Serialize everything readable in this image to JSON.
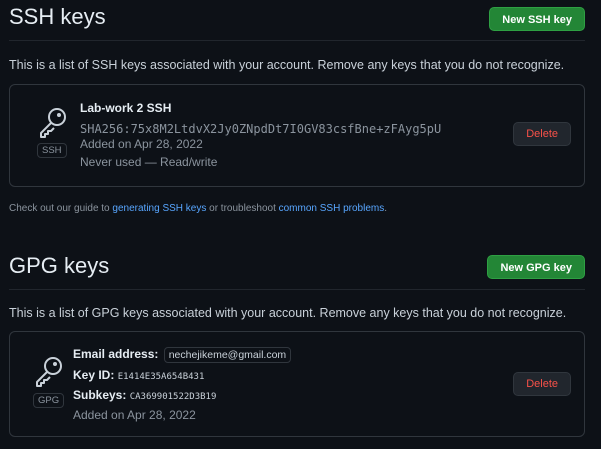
{
  "ssh": {
    "title": "SSH keys",
    "new_button": "New SSH key",
    "description": "This is a list of SSH keys associated with your account. Remove any keys that you do not recognize.",
    "key": {
      "badge": "SSH",
      "name": "Lab-work 2 SSH",
      "fingerprint": "SHA256:75x8M2LtdvX2Jy0ZNpdDt7I0GV83csfBne+zFAyg5pU",
      "added": "Added on Apr 28, 2022",
      "usage": "Never used — Read/write",
      "delete_label": "Delete"
    }
  },
  "guide": {
    "prefix": "Check out our guide to ",
    "link1": "generating SSH keys",
    "middle": " or troubleshoot ",
    "link2": "common SSH problems",
    "suffix": "."
  },
  "gpg": {
    "title": "GPG keys",
    "new_button": "New GPG key",
    "description": "This is a list of GPG keys associated with your account. Remove any keys that you do not recognize.",
    "key": {
      "badge": "GPG",
      "email_label": "Email address:",
      "email": "nechejikeme@gmail.com",
      "key_id_label": "Key ID:",
      "key_id": "E1414E35A654B431",
      "subkeys_label": "Subkeys:",
      "subkeys": "CA369901522D3B19",
      "added": "Added on Apr 28, 2022",
      "delete_label": "Delete"
    }
  },
  "icons": {
    "key": "key-icon"
  },
  "colors": {
    "background": "#0d1117",
    "primary_button": "#238636",
    "danger_text": "#f85149",
    "link": "#58a6ff",
    "border": "#30363d"
  }
}
